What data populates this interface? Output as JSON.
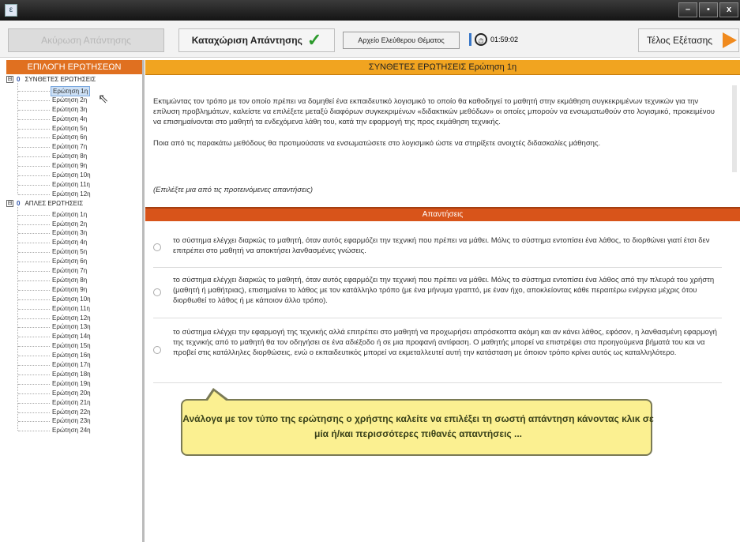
{
  "titlebar": {
    "app_icon": "ε",
    "minimize": "–",
    "maximize": "▪",
    "close": "x"
  },
  "toolbar": {
    "cancel_label": "Ακύρωση Απάντησης",
    "submit_label": "Καταχώριση Απάντησης",
    "submit_icon": "✓",
    "archive_label": "Αρχείο Ελεύθερου Θέματος",
    "timer": "01:59:02",
    "end_label": "Τέλος Εξέτασης"
  },
  "sidebar": {
    "header": "ΕΠΙΛΟΓΗ ΕΡΩΤΗΣΕΩΝ",
    "groups": [
      {
        "toggle": "⊟",
        "count": "0",
        "title": "ΣΥΝΘΕΤΕΣ ΕΡΩΤΗΣΕΙΣ",
        "items": [
          "Ερώτηση 1η",
          "Ερώτηση 2η",
          "Ερώτηση 3η",
          "Ερώτηση 4η",
          "Ερώτηση 5η",
          "Ερώτηση 6η",
          "Ερώτηση 7η",
          "Ερώτηση 8η",
          "Ερώτηση 9η",
          "Ερώτηση 10η",
          "Ερώτηση 11η",
          "Ερώτηση 12η"
        ]
      },
      {
        "toggle": "⊟",
        "count": "0",
        "title": "ΑΠΛΕΣ ΕΡΩΤΗΣΕΙΣ",
        "items": [
          "Ερώτηση 1η",
          "Ερώτηση 2η",
          "Ερώτηση 3η",
          "Ερώτηση 4η",
          "Ερώτηση 5η",
          "Ερώτηση 6η",
          "Ερώτηση 7η",
          "Ερώτηση 8η",
          "Ερώτηση 9η",
          "Ερώτηση 10η",
          "Ερώτηση 11η",
          "Ερώτηση 12η",
          "Ερώτηση 13η",
          "Ερώτηση 14η",
          "Ερώτηση 15η",
          "Ερώτηση 16η",
          "Ερώτηση 17η",
          "Ερώτηση 18η",
          "Ερώτηση 19η",
          "Ερώτηση 20η",
          "Ερώτηση 21η",
          "Ερώτηση 22η",
          "Ερώτηση 23η",
          "Ερώτηση 24η"
        ]
      }
    ],
    "selected": "ΣΥΝΘΕΤΕΣ ΕΡΩΤΗΣΕΙΣ / Ερώτηση 1η"
  },
  "main": {
    "header": "ΣΥΝΘΕΤΕΣ ΕΡΩΤΗΣΕΙΣ Ερώτηση 1η",
    "question_p1": "Εκτιμώντας τον τρόπο με τον οποίο πρέπει να δομηθεί ένα εκπαιδευτικό λογισμικό το οποίο θα καθοδηγεί το μαθητή στην εκμάθηση συγκεκριμένων τεχνικών για την επίλυση προβλημάτων, καλείστε να επιλέξετε μεταξύ διαφόρων συγκεκριμένων «διδακτικών μεθόδων» οι οποίες μπορούν να ενσωματωθούν στο λογισμικό, προκειμένου να επισημαίνονται στο μαθητή τα ενδεχόμενα λάθη του, κατά την εφαρμογή της προς εκμάθηση τεχνικής.",
    "question_p2": "Ποια από τις παρακάτω μεθόδους θα προτιμούσατε να ενσωματώσετε στο λογισμικό ώστε να στηρίξετε ανοιχτές διδασκαλίες μάθησης.",
    "hint": "(Επιλέξτε μια από τις προτεινόμενες απαντήσεις)",
    "answers_header": "Απαντήσεις",
    "answers": [
      "το σύστημα ελέγχει διαρκώς το μαθητή, όταν αυτός εφαρμόζει την τεχνική που πρέπει να μάθει. Μόλις το σύστημα εντοπίσει ένα λάθος, το διορθώνει γιατί έτσι δεν επιτρέπει στο μαθητή να αποκτήσει λανθασμένες γνώσεις.",
      "το σύστημα ελέγχει διαρκώς το μαθητή, όταν αυτός εφαρμόζει την τεχνική που πρέπει να μάθει. Μόλις το σύστημα εντοπίσει ένα λάθος από την πλευρά του χρήστη (μαθητή ή μαθήτριας), επισημαίνει το λάθος με τον κατάλληλο τρόπο (με ένα μήνυμα γραπτό, με έναν ήχο, αποκλείοντας κάθε περαιτέρω ενέργεια μέχρις ότου διορθωθεί το λάθος ή με κάποιον άλλο τρόπο).",
      "το σύστημα ελέγχει την εφαρμογή της τεχνικής αλλά επιτρέπει στο μαθητή να προχωρήσει απρόσκοπτα ακόμη και αν κάνει λάθος, εφόσον, η λανθασμένη εφαρμογή της τεχνικής από το μαθητή θα τον οδηγήσει σε ένα αδιέξοδο ή σε μια προφανή αντίφαση. Ο μαθητής μπορεί να επιστρέψει στα προηγούμενα βήματά του και να προβεί στις κατάλληλες διορθώσεις, ενώ ο εκπαιδευτικός μπορεί να εκμεταλλευτεί αυτή την κατάσταση με όποιον τρόπο κρίνει αυτός ως καταλληλότερο."
    ],
    "callout": "Ανάλογα με τον τύπο της ερώτησης ο χρήστης καλείτε να επιλέξει τη σωστή απάντηση κάνοντας κλικ σε μία ή/και περισσότερες πιθανές απαντήσεις ..."
  }
}
